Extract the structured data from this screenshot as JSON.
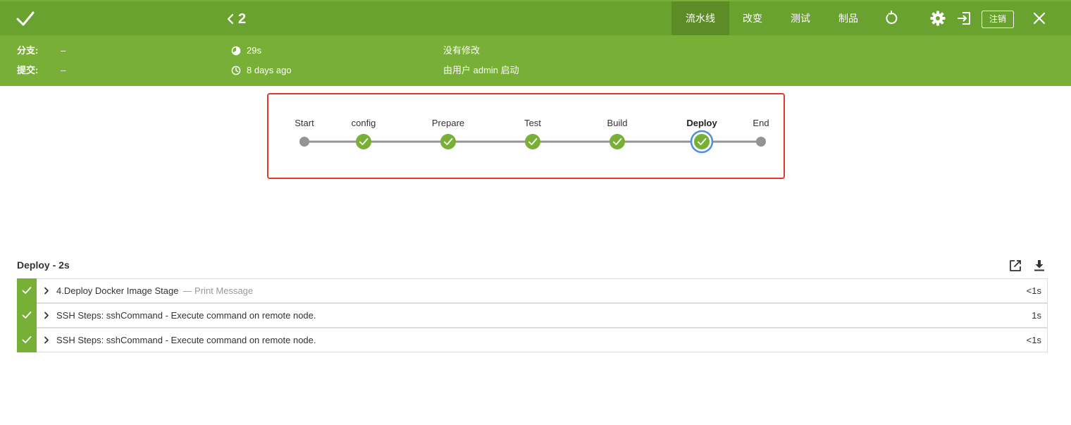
{
  "header": {
    "run_number": "2",
    "tabs": [
      {
        "label": "流水线",
        "active": true
      },
      {
        "label": "改变",
        "active": false
      },
      {
        "label": "测试",
        "active": false
      },
      {
        "label": "制品",
        "active": false
      }
    ],
    "logout_label": "注销",
    "icons": [
      "check-icon",
      "chevron-left-icon",
      "replay-icon",
      "gear-icon",
      "sign-in-icon",
      "close-icon"
    ],
    "colors": {
      "top": "#6aa22f",
      "meta": "#78b037",
      "active_tab": "#5d8c27"
    }
  },
  "meta": {
    "branch_label": "分支:",
    "branch_value": "–",
    "commit_label": "提交:",
    "commit_value": "–",
    "duration": "29s",
    "time_ago": "8 days ago",
    "changes": "没有修改",
    "started_by": "由用户 admin 启动"
  },
  "pipeline": {
    "stages": [
      {
        "label": "Start",
        "status": "terminal"
      },
      {
        "label": "config",
        "status": "success"
      },
      {
        "label": "Prepare",
        "status": "success"
      },
      {
        "label": "Test",
        "status": "success"
      },
      {
        "label": "Build",
        "status": "success"
      },
      {
        "label": "Deploy",
        "status": "success",
        "selected": true
      },
      {
        "label": "End",
        "status": "terminal"
      }
    ],
    "colors": {
      "success": "#78b037",
      "terminal": "#949494",
      "line": "#949494",
      "selected": "#4a90e2"
    }
  },
  "log": {
    "title": "Deploy - 2s",
    "steps": [
      {
        "text": "4.Deploy Docker Image Stage",
        "subtext": "— Print Message",
        "duration": "<1s"
      },
      {
        "text": "SSH Steps: sshCommand - Execute command on remote node.",
        "subtext": "",
        "duration": "1s"
      },
      {
        "text": "SSH Steps: sshCommand - Execute command on remote node.",
        "subtext": "",
        "duration": "<1s"
      }
    ]
  }
}
